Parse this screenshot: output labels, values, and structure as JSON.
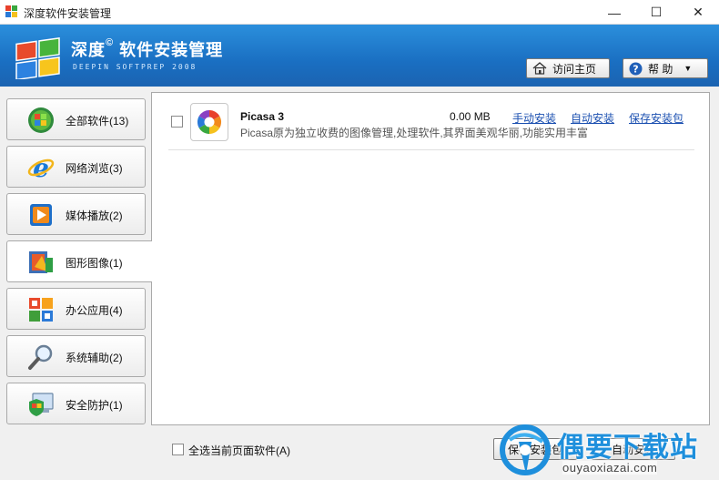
{
  "window": {
    "title": "深度软件安装管理",
    "minimize": "—",
    "maximize": "☐",
    "close": "✕"
  },
  "banner": {
    "title": "深度",
    "title_mark": "©",
    "title_rest": "软件安装管理",
    "subtitle": "DEEPIN SOFTPREP 2008",
    "home_button": "访问主页",
    "help_button": "帮 助",
    "help_caret": "▼"
  },
  "sidebar": {
    "items": [
      {
        "label": "全部软件(13)",
        "icon": "windows-orb-icon"
      },
      {
        "label": "网络浏览(3)",
        "icon": "ie-browser-icon"
      },
      {
        "label": "媒体播放(2)",
        "icon": "media-player-icon"
      },
      {
        "label": "图形图像(1)",
        "icon": "graphics-image-icon"
      },
      {
        "label": "办公应用(4)",
        "icon": "office-icon"
      },
      {
        "label": "系统辅助(2)",
        "icon": "magnifier-icon"
      },
      {
        "label": "安全防护(1)",
        "icon": "security-icon"
      }
    ],
    "active_index": 3
  },
  "software_list": [
    {
      "name": "Picasa 3",
      "size": "0.00 MB",
      "manual_install": "手动安装",
      "auto_install": "自动安装",
      "save_package": "保存安装包",
      "description": "Picasa原为独立收费的图像管理,处理软件,其界面美观华丽,功能实用丰富"
    }
  ],
  "footer": {
    "select_all": "全选当前页面软件(A)",
    "save_button": "保存安装包",
    "auto_button": "自动安装"
  },
  "watermark": {
    "title": "偶要下载站",
    "url": "ouyaoxiazai.com"
  },
  "colors": {
    "banner": "#1a6fc2",
    "link": "#1a4fb0",
    "watermark": "#1e8fdc"
  }
}
